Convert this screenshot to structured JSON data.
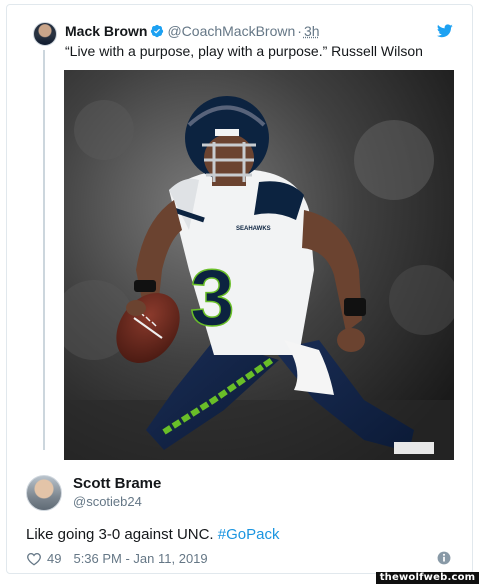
{
  "quoted_tweet": {
    "author_name": "Mack Brown",
    "author_handle": "@CoachMackBrown",
    "time": "3h",
    "text": "“Live with a purpose, play with a purpose.” Russell Wilson",
    "photo_jersey_number": "3",
    "photo_jersey_wordmark": "SEAHAWKS"
  },
  "tweet": {
    "author_name": "Scott Brame",
    "author_handle": "@scotieb24",
    "text_before": "Like going 3-0 against UNC. ",
    "hashtag": "#GoPack",
    "like_count": "49",
    "timestamp": "5:36 PM - Jan 11, 2019"
  },
  "watermark": "thewolfweb.com",
  "icons": {
    "verified": "verified-badge-icon",
    "twitter": "twitter-bird-icon",
    "like": "heart-icon",
    "info": "info-icon"
  },
  "colors": {
    "link": "#1b95e0",
    "muted": "#657786",
    "verified": "#1da1f2",
    "seahawks_navy": "#0c2340",
    "seahawks_green": "#69be28"
  }
}
